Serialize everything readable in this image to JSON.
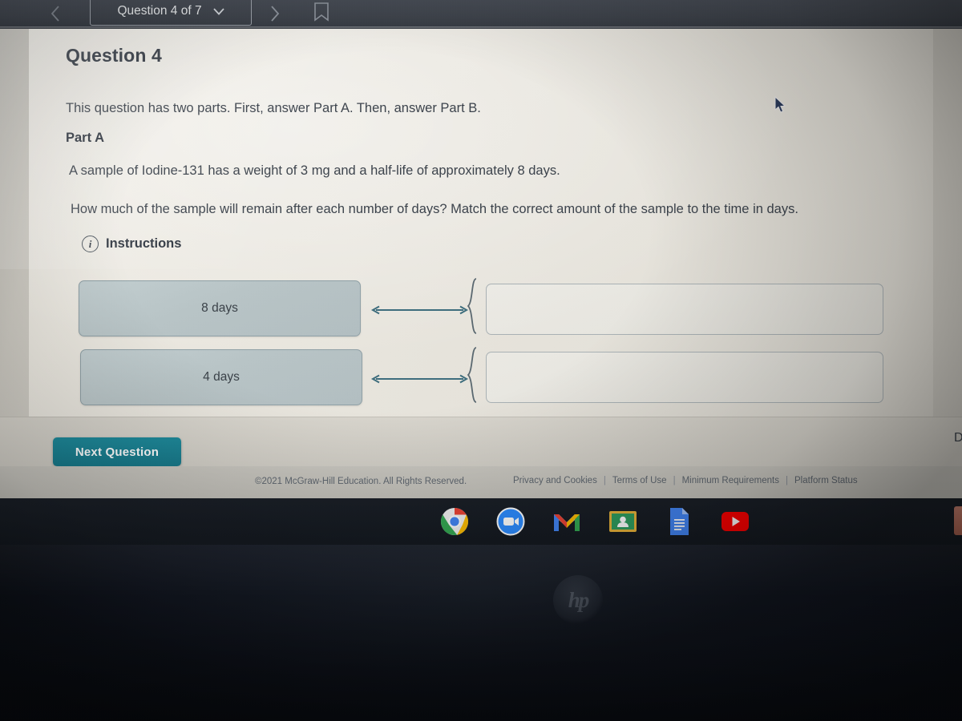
{
  "topbar": {
    "prev_icon": "chevron-left-icon",
    "question_selector": "Question 4 of 7",
    "selector_chevron": "chevron-down-icon",
    "next_icon": "chevron-right-icon",
    "bookmark_icon": "bookmark-icon"
  },
  "question": {
    "title": "Question 4",
    "intro": "This question has two parts. First, answer Part A. Then, answer Part B.",
    "part_label": "Part A",
    "stem_line_1": "A sample of Iodine-131 has a weight of 3 mg and a half-life of approximately 8 days.",
    "stem_line_2": "How much of the sample will remain after each number of days? Match the correct amount of the sample to the time in days.",
    "instructions_label": "Instructions",
    "instructions_icon": "info-circle-icon"
  },
  "matching": {
    "rows": [
      {
        "tile_label": "8 days",
        "arrow_icon": "double-arrow-icon",
        "brace_icon": "curly-brace-icon",
        "drop_value": ""
      },
      {
        "tile_label": "4 days",
        "arrow_icon": "double-arrow-icon",
        "brace_icon": "curly-brace-icon",
        "drop_value": ""
      }
    ]
  },
  "edge": {
    "cut_off_text": "D"
  },
  "actions": {
    "next_question_label": "Next Question"
  },
  "footer": {
    "copyright": "©2021 McGraw-Hill Education. All Rights Reserved.",
    "links": [
      "Privacy and Cookies",
      "Terms of Use",
      "Minimum Requirements",
      "Platform Status"
    ],
    "separator": "|"
  },
  "shelf": {
    "icons": [
      "chrome-icon",
      "zoom-icon",
      "gmail-icon",
      "google-classroom-icon",
      "google-docs-icon",
      "youtube-icon"
    ]
  },
  "device": {
    "brand_logo": "hp"
  },
  "colors": {
    "topbar": "#40454d",
    "accent_button": "#1b8395",
    "tile_fill": "#b9c5c7",
    "page_background": "#e6e3db",
    "text": "#3c434c"
  }
}
